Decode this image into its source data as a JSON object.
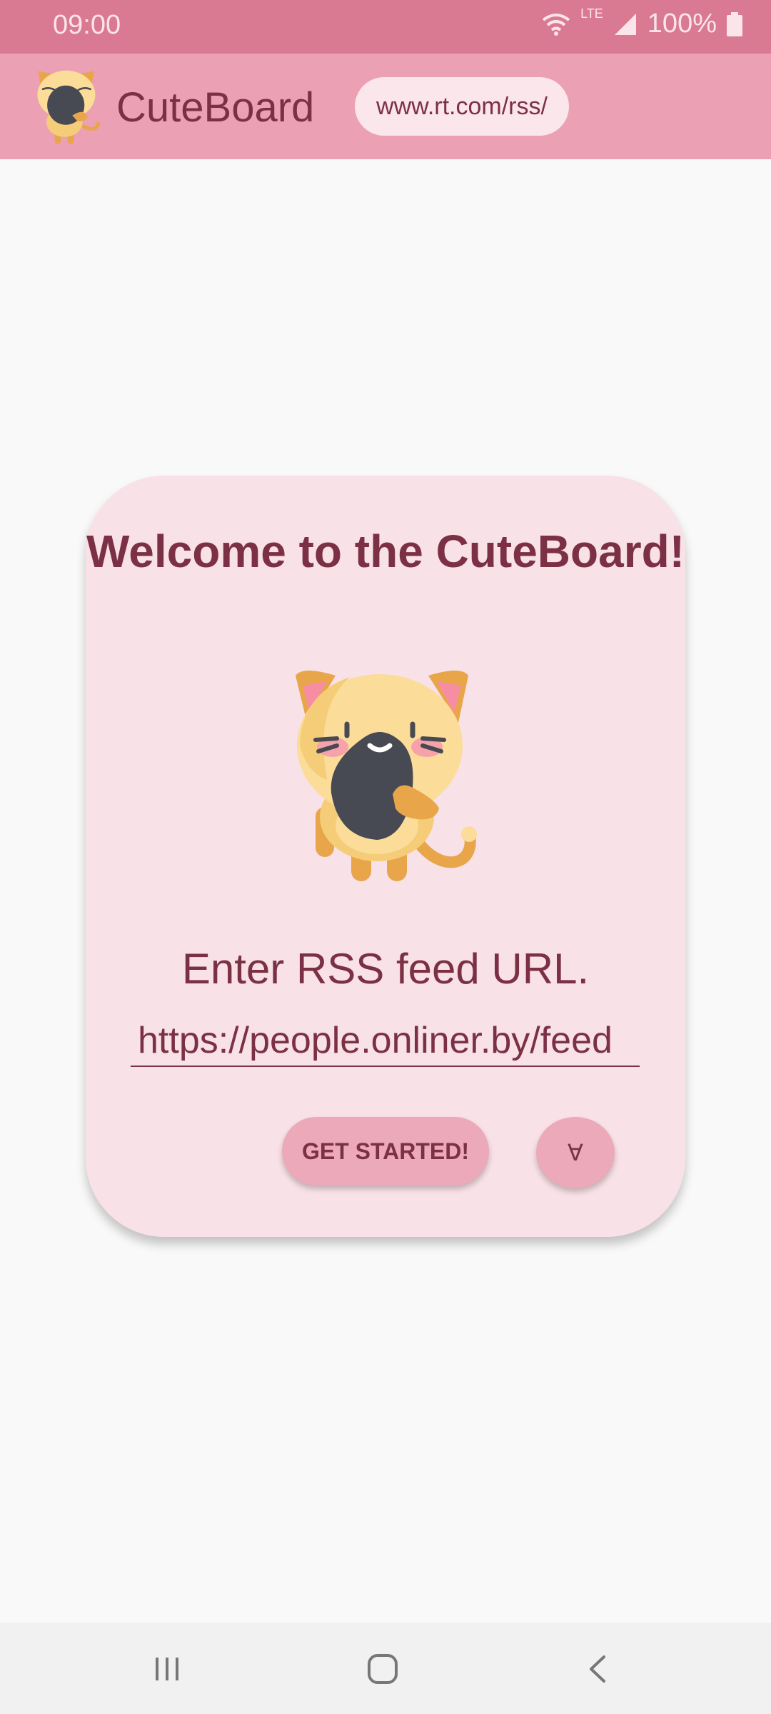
{
  "status_bar": {
    "time": "09:00",
    "network": "LTE",
    "battery": "100%",
    "icons": [
      "wifi-icon",
      "signal-icon",
      "battery-icon"
    ]
  },
  "app_bar": {
    "title": "CuteBoard",
    "url_chip": "www.rt.com/rss/",
    "logo_icon": "cat-logo-icon"
  },
  "card": {
    "welcome": "Welcome to the CuteBoard!",
    "prompt": "Enter RSS feed URL.",
    "url_input": {
      "value": "https://people.onliner.by/feed"
    },
    "start_button": "GET STARTED!",
    "secondary_button": "∀"
  },
  "nav_bar": {
    "icons": [
      "recents-icon",
      "home-icon",
      "back-icon"
    ]
  },
  "colors": {
    "status_bar": "#d97a92",
    "app_bar": "#eba0b3",
    "card": "#f8e1e7",
    "button": "#eba9ba",
    "text": "#7c3046",
    "background": "#f9f9f9"
  }
}
